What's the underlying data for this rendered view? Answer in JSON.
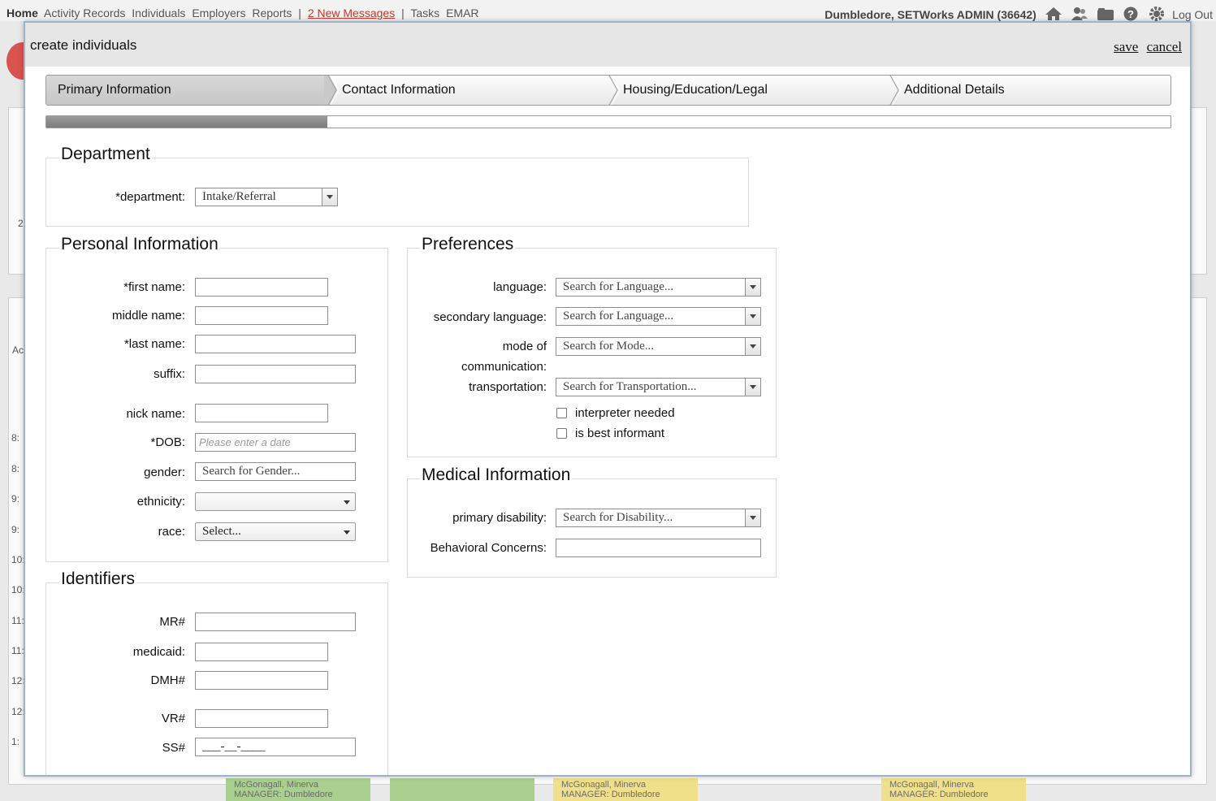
{
  "app": {
    "nav": {
      "home": "Home",
      "activity_records": "Activity Records",
      "individuals": "Individuals",
      "employers": "Employers",
      "reports": "Reports",
      "separator": "|",
      "messages": "2 New Messages",
      "tasks": "Tasks",
      "emar": "EMAR"
    },
    "user": "Dumbledore, SETWorks ADMIN (36642)",
    "logout": "Log Out",
    "icons": [
      "home-icon",
      "people-icon",
      "folder-icon",
      "help-icon",
      "gear-icon"
    ],
    "schedule_rows": [
      "8:",
      "8:",
      "9:",
      "9:",
      "10:",
      "10:",
      "11:",
      "11:",
      "12:",
      "12:",
      "1:"
    ],
    "schedule_chips": [
      {
        "name": "McGonagall, Minerva",
        "manager": "MANAGER: Dumbledore",
        "color": "#a9d08e"
      },
      {
        "name": "",
        "manager": "",
        "color": "#a9d08e"
      },
      {
        "name": "McGonagall, Minerva",
        "manager": "MANAGER: Dumbledore",
        "color": "#f0e08a"
      },
      {
        "name": "McGonagall, Minerva",
        "manager": "MANAGER: Dumbledore",
        "color": "#f0e08a"
      }
    ],
    "bg_misc": {
      "row_digit": "2",
      "row_ac": "Ac"
    }
  },
  "modal": {
    "title": "create individuals",
    "save": "save",
    "cancel": "cancel",
    "steps": [
      {
        "label": "Primary Information",
        "active": true
      },
      {
        "label": "Contact Information",
        "active": false
      },
      {
        "label": "Housing/Education/Legal",
        "active": false
      },
      {
        "label": "Additional Details",
        "active": false
      }
    ],
    "progress_fraction": 0.25,
    "department": {
      "legend": "Department",
      "label": "*department:",
      "value": "Intake/Referral"
    },
    "personal": {
      "legend": "Personal Information",
      "first_name": {
        "label": "*first name:",
        "value": ""
      },
      "middle_name": {
        "label": "middle name:",
        "value": ""
      },
      "last_name": {
        "label": "*last name:",
        "value": ""
      },
      "suffix": {
        "label": "suffix:",
        "value": ""
      },
      "nick_name": {
        "label": "nick name:",
        "value": ""
      },
      "dob": {
        "label": "*DOB:",
        "placeholder": "Please enter a date"
      },
      "gender": {
        "label": "gender:",
        "placeholder": "Search for Gender..."
      },
      "ethnicity": {
        "label": "ethnicity:",
        "value": ""
      },
      "race": {
        "label": "race:",
        "value": "Select..."
      }
    },
    "identifiers": {
      "legend": "Identifiers",
      "mr": {
        "label": "MR#",
        "value": ""
      },
      "medicaid": {
        "label": "medicaid:",
        "value": ""
      },
      "dmh": {
        "label": "DMH#",
        "value": ""
      },
      "vr": {
        "label": "VR#",
        "value": ""
      },
      "ss": {
        "label": "SS#",
        "value": "___-__-____"
      }
    },
    "preferences": {
      "legend": "Preferences",
      "language": {
        "label": "language:",
        "placeholder": "Search for Language..."
      },
      "secondary_language": {
        "label": "secondary language:",
        "placeholder": "Search for Language..."
      },
      "mode_label_1": "mode of",
      "mode_label_2": "communication:",
      "mode": {
        "placeholder": "Search for Mode..."
      },
      "transportation": {
        "label": "transportation:",
        "placeholder": "Search for Transportation..."
      },
      "interpreter_needed": {
        "label": "interpreter needed",
        "checked": false
      },
      "best_informant": {
        "label": "is best informant",
        "checked": false
      }
    },
    "medical": {
      "legend": "Medical Information",
      "primary_disability": {
        "label": "primary disability:",
        "placeholder": "Search for Disability..."
      },
      "behavioral_concerns": {
        "label": "Behavioral Concerns:",
        "value": ""
      }
    }
  }
}
